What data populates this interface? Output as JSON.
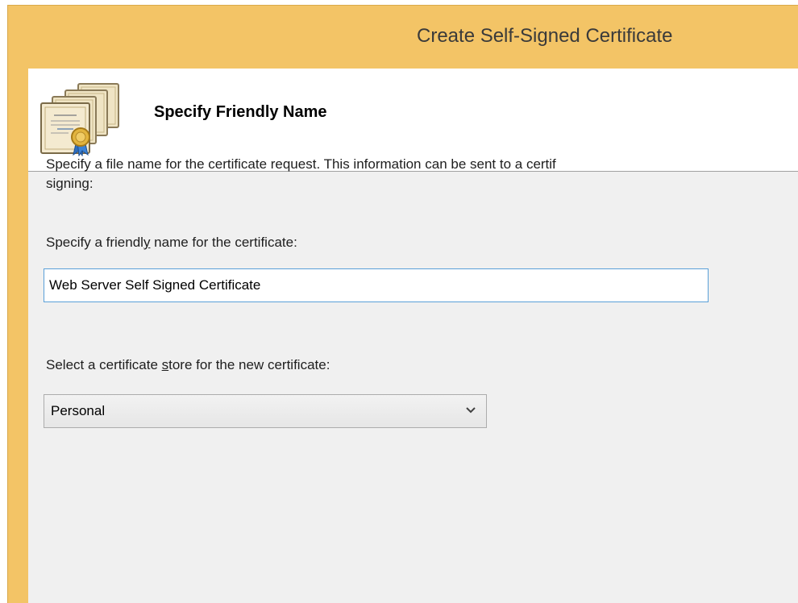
{
  "window": {
    "title": "Create Self-Signed Certificate"
  },
  "header": {
    "title": "Specify Friendly Name",
    "icon": "certificate-icon"
  },
  "description": {
    "line1": "Specify a file name for the certificate request.  This information can be sent to a certif",
    "line2": "signing:"
  },
  "friendly_name": {
    "label_before": "Specify a friendl",
    "label_accel": "y",
    "label_after": " name for the certificate:",
    "value": "Web Server Self Signed Certificate"
  },
  "store": {
    "label_before": "Select a certificate ",
    "label_accel": "s",
    "label_after": "tore for the new certificate:",
    "selected": "Personal",
    "arrow_icon": "chevron-down-icon"
  },
  "colors": {
    "titlebar": "#f3c466",
    "client_bg": "#f0f0f0",
    "input_border": "#5aa0d8"
  }
}
